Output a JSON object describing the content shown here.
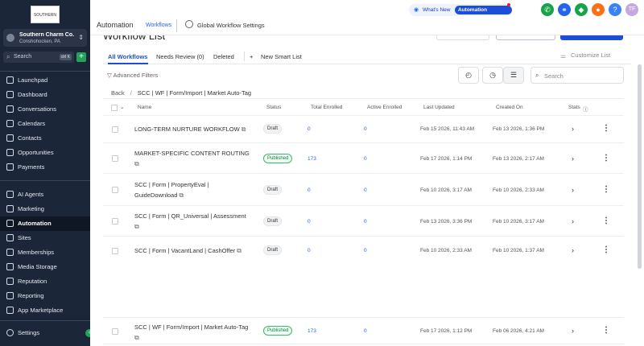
{
  "sidebar": {
    "logo_text": "SOUTHERN CHARM",
    "location_name": "Southern Charm Co...",
    "location_sub": "Conshohocken, PA",
    "search_placeholder": "Search",
    "search_shortcut": "ctrl K",
    "items": [
      {
        "label": "Launchpad",
        "icon": "launchpad-icon"
      },
      {
        "label": "Dashboard",
        "icon": "dashboard-icon"
      },
      {
        "label": "Conversations",
        "icon": "chat-icon"
      },
      {
        "label": "Calendars",
        "icon": "calendar-icon"
      },
      {
        "label": "Contacts",
        "icon": "contacts-icon"
      },
      {
        "label": "Opportunities",
        "icon": "opportunities-icon"
      },
      {
        "label": "Payments",
        "icon": "payments-icon"
      },
      {
        "label": "AI Agents",
        "icon": "ai-icon"
      },
      {
        "label": "Marketing",
        "icon": "marketing-icon"
      },
      {
        "label": "Automation",
        "icon": "automation-icon",
        "active": true
      },
      {
        "label": "Sites",
        "icon": "sites-icon"
      },
      {
        "label": "Memberships",
        "icon": "memberships-icon"
      },
      {
        "label": "Media Storage",
        "icon": "media-icon"
      },
      {
        "label": "Reputation",
        "icon": "star-icon"
      },
      {
        "label": "Reporting",
        "icon": "reporting-icon"
      },
      {
        "label": "App Marketplace",
        "icon": "marketplace-icon"
      }
    ],
    "settings": "Settings"
  },
  "topbar": {
    "title": "Automation",
    "tab": "Workflows",
    "global_workflow": "Global Workflow Settings",
    "whats_new": "What's New",
    "updates_pill": "Automation Updates",
    "avatar": "TF",
    "help": "?"
  },
  "main": {
    "page_title": "Workflow List",
    "tabs": [
      "All Workflows",
      "Needs Review (0)",
      "Deleted",
      "New Smart List"
    ],
    "customize": "Customize List",
    "advanced_filters": "Advanced Filters",
    "search_placeholder": "Search",
    "breadcrumb": {
      "back": "Back",
      "path": "SCC | WF | Form/Import | Market Auto-Tag"
    },
    "columns": [
      "Name",
      "Status",
      "Total Enrolled",
      "Active Enrolled",
      "Last Updated",
      "Created On",
      "Stats"
    ],
    "rows": [
      {
        "name": "LONG-TERM NURTURE WORKFLOW",
        "status": "Draft",
        "total": "0",
        "active": "0",
        "updated": "Feb 15 2026, 11:43 AM",
        "created": "Feb 13 2026, 1:36 PM"
      },
      {
        "name": "MARKET-SPECIFIC CONTENT ROUTING",
        "status": "Published",
        "total": "173",
        "active": "0",
        "updated": "Feb 17 2026, 1:14 PM",
        "created": "Feb 13 2026, 2:17 AM"
      },
      {
        "name": "SCC | Form | PropertyEval | GuideDownload",
        "status": "Draft",
        "total": "0",
        "active": "0",
        "updated": "Feb 10 2026, 3:17 AM",
        "created": "Feb 10 2026, 2:33 AM"
      },
      {
        "name": "SCC | Form | QR_Universal | Assessment",
        "status": "Draft",
        "total": "0",
        "active": "0",
        "updated": "Feb 13 2026, 3:36 PM",
        "created": "Feb 10 2026, 3:17 AM"
      },
      {
        "name": "SCC | Form | VacantLand | CashOffer",
        "status": "Draft",
        "total": "0",
        "active": "0",
        "updated": "Feb 10 2026, 2:33 AM",
        "created": "Feb 10 2026, 1:37 AM"
      },
      {
        "name": "SCC | WF | Form/Import | Market Auto-Tag",
        "status": "Published",
        "total": "173",
        "active": "0",
        "updated": "Feb 17 2026, 1:12 PM",
        "created": "Feb 06 2026, 4:21 AM"
      }
    ]
  }
}
